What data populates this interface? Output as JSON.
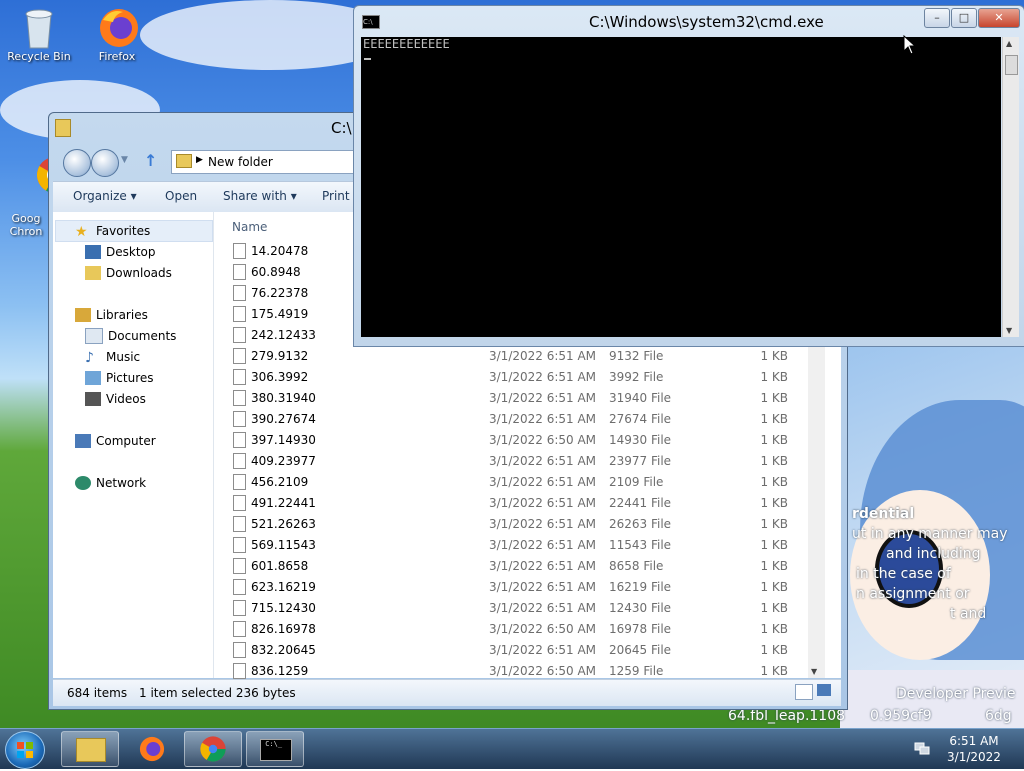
{
  "desktop": {
    "icons": [
      {
        "label": "Recycle Bin"
      },
      {
        "label": "Firefox"
      },
      {
        "label": "Goog\nChron"
      }
    ],
    "watermark_lines": [
      "rdential",
      "ut in any manner may",
      "and including",
      "in the case of",
      "n assignment or",
      "t and",
      "Developer Previe",
      "64.fbl_leap.1108",
      "0.959cf9",
      "6dg"
    ]
  },
  "explorer": {
    "title": "C:\\",
    "breadcrumb": "New folder",
    "toolbar": {
      "organize": "Organize",
      "open": "Open",
      "share_with": "Share with",
      "print": "Print"
    },
    "nav": {
      "favorites": "Favorites",
      "desktop": "Desktop",
      "downloads": "Downloads",
      "libraries": "Libraries",
      "documents": "Documents",
      "music": "Music",
      "pictures": "Pictures",
      "videos": "Videos",
      "computer": "Computer",
      "network": "Network"
    },
    "column_name": "Name",
    "files": [
      {
        "name": "14.20478",
        "date": "",
        "type": "",
        "size": ""
      },
      {
        "name": "60.8948",
        "date": "",
        "type": "",
        "size": ""
      },
      {
        "name": "76.22378",
        "date": "",
        "type": "",
        "size": ""
      },
      {
        "name": "175.4919",
        "date": "",
        "type": "",
        "size": ""
      },
      {
        "name": "242.12433",
        "date": "",
        "type": "",
        "size": ""
      },
      {
        "name": "279.9132",
        "date": "3/1/2022 6:51 AM",
        "type": "9132 File",
        "size": "1 KB"
      },
      {
        "name": "306.3992",
        "date": "3/1/2022 6:51 AM",
        "type": "3992 File",
        "size": "1 KB"
      },
      {
        "name": "380.31940",
        "date": "3/1/2022 6:51 AM",
        "type": "31940 File",
        "size": "1 KB"
      },
      {
        "name": "390.27674",
        "date": "3/1/2022 6:51 AM",
        "type": "27674 File",
        "size": "1 KB"
      },
      {
        "name": "397.14930",
        "date": "3/1/2022 6:50 AM",
        "type": "14930 File",
        "size": "1 KB"
      },
      {
        "name": "409.23977",
        "date": "3/1/2022 6:51 AM",
        "type": "23977 File",
        "size": "1 KB"
      },
      {
        "name": "456.2109",
        "date": "3/1/2022 6:51 AM",
        "type": "2109 File",
        "size": "1 KB"
      },
      {
        "name": "491.22441",
        "date": "3/1/2022 6:51 AM",
        "type": "22441 File",
        "size": "1 KB"
      },
      {
        "name": "521.26263",
        "date": "3/1/2022 6:51 AM",
        "type": "26263 File",
        "size": "1 KB"
      },
      {
        "name": "569.11543",
        "date": "3/1/2022 6:51 AM",
        "type": "11543 File",
        "size": "1 KB"
      },
      {
        "name": "601.8658",
        "date": "3/1/2022 6:51 AM",
        "type": "8658 File",
        "size": "1 KB"
      },
      {
        "name": "623.16219",
        "date": "3/1/2022 6:51 AM",
        "type": "16219 File",
        "size": "1 KB"
      },
      {
        "name": "715.12430",
        "date": "3/1/2022 6:51 AM",
        "type": "12430 File",
        "size": "1 KB"
      },
      {
        "name": "826.16978",
        "date": "3/1/2022 6:50 AM",
        "type": "16978 File",
        "size": "1 KB"
      },
      {
        "name": "832.20645",
        "date": "3/1/2022 6:51 AM",
        "type": "20645 File",
        "size": "1 KB"
      },
      {
        "name": "836.1259",
        "date": "3/1/2022 6:50 AM",
        "type": "1259 File",
        "size": "1 KB"
      }
    ],
    "status": {
      "items": "684 items",
      "selected": "1 item selected  236 bytes"
    }
  },
  "cmd": {
    "title": "C:\\Windows\\system32\\cmd.exe",
    "output": "EEEEEEEEEEEE",
    "icon_label": "C:\\"
  },
  "taskbar": {
    "time": "6:51 AM",
    "date": "3/1/2022"
  }
}
